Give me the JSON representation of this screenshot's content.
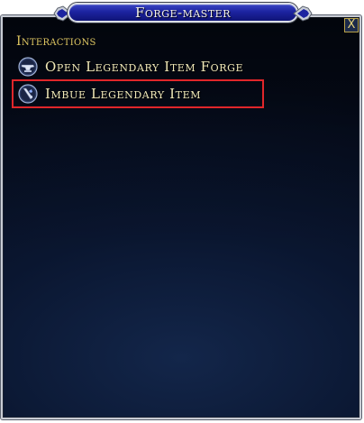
{
  "window": {
    "title": "Forge-master"
  },
  "close_button": {
    "label": "X",
    "icon": "close-icon"
  },
  "interactions": {
    "header": "Interactions",
    "options": [
      {
        "label": "Open Legendary Item Forge",
        "icon": "forge-anvil-icon"
      },
      {
        "label": "Imbue Legendary Item",
        "icon": "imbue-sword-icon",
        "highlighted": true
      }
    ]
  },
  "colors": {
    "title_bar": "#1c23a0",
    "panel_background": "#0a1630",
    "header_text": "#e0c862",
    "option_text": "#f1e9b8",
    "highlight_border": "#e0262a"
  }
}
